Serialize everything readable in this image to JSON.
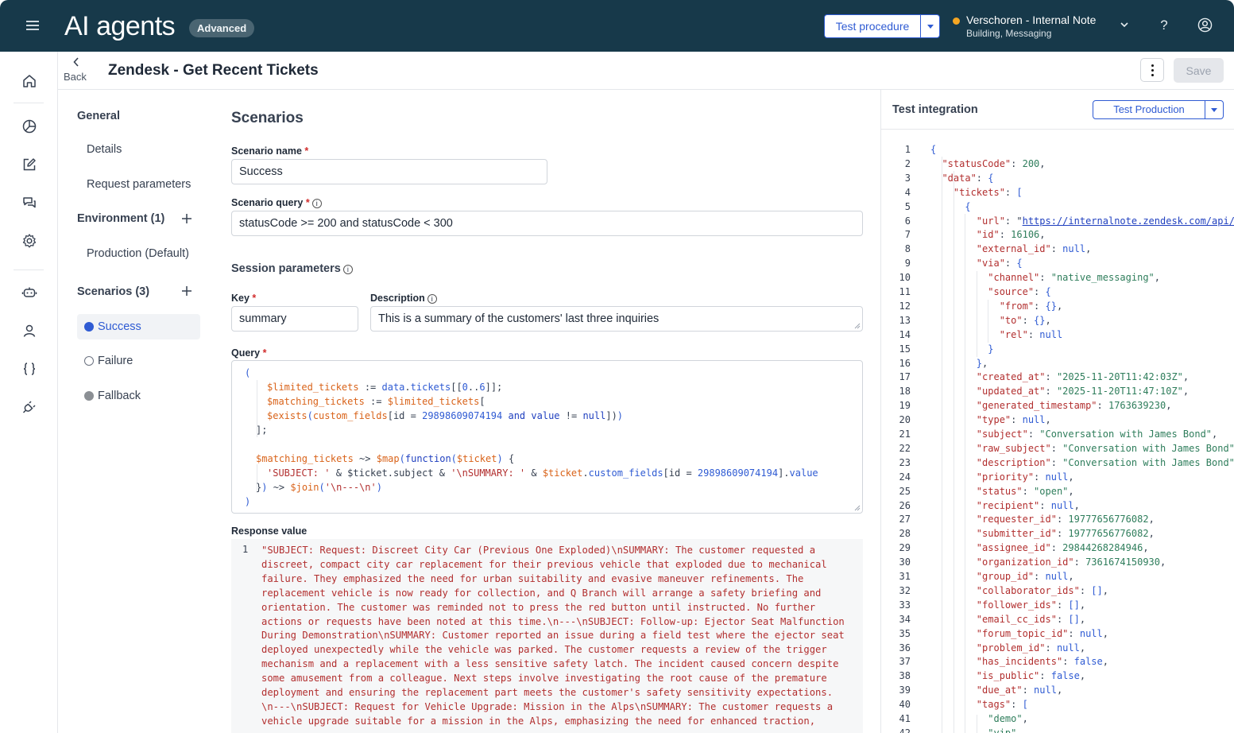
{
  "header": {
    "app_title": "AI agents",
    "badge": "Advanced",
    "test_procedure_label": "Test procedure",
    "org_name": "Verschoren - Internal Note",
    "org_sub": "Building, Messaging",
    "help": "?"
  },
  "page": {
    "back_label": "Back",
    "title": "Zendesk - Get Recent Tickets",
    "save_label": "Save"
  },
  "nav": {
    "general": "General",
    "details": "Details",
    "request_parameters": "Request parameters",
    "environment": "Environment (1)",
    "production": "Production (Default)",
    "scenarios": "Scenarios (3)",
    "scenario_items": [
      {
        "label": "Success",
        "color": "#2f5bd3"
      },
      {
        "label": "Failure",
        "color": "#ffffff"
      },
      {
        "label": "Fallback",
        "color": "#8b8f94"
      }
    ]
  },
  "form": {
    "heading": "Scenarios",
    "scenario_name_label": "Scenario name",
    "scenario_name_value": "Success",
    "scenario_query_label": "Scenario query",
    "scenario_query_value": "statusCode >= 200 and statusCode < 300",
    "session_params_heading": "Session parameters",
    "key_label": "Key",
    "key_value": "summary",
    "description_label": "Description",
    "description_value": "This is a summary of the customers' last three inquiries",
    "query_label": "Query",
    "required_mark": "*",
    "info_mark": "i",
    "query_lines": [
      [
        [
          "c-par",
          "("
        ]
      ],
      [
        [
          "c-var",
          "$limited_tickets"
        ],
        [
          "c-op",
          " := "
        ],
        [
          "c-id",
          "data"
        ],
        [
          "c-op",
          "."
        ],
        [
          "c-id",
          "tickets"
        ],
        [
          "c-op",
          "[["
        ],
        [
          "c-num",
          "0"
        ],
        [
          "c-op",
          ".."
        ],
        [
          "c-num",
          "6"
        ],
        [
          "c-op",
          "]];"
        ]
      ],
      [
        [
          "c-var",
          "$matching_tickets"
        ],
        [
          "c-op",
          " := "
        ],
        [
          "c-var",
          "$limited_tickets"
        ],
        [
          "c-op",
          "["
        ]
      ],
      [
        [
          "c-fn",
          "$exists"
        ],
        [
          "c-par",
          "("
        ],
        [
          "c-var",
          "custom_fields"
        ],
        [
          "c-op",
          "[id = "
        ],
        [
          "c-num",
          "29898609074194"
        ],
        [
          "c-op",
          " "
        ],
        [
          "c-kw",
          "and"
        ],
        [
          "c-op",
          " "
        ],
        [
          "c-kw",
          "value"
        ],
        [
          "c-op",
          " != "
        ],
        [
          "c-kw",
          "null"
        ],
        [
          "c-op",
          "])"
        ],
        [
          "c-par",
          ")"
        ]
      ],
      [
        [
          "c-op",
          "];"
        ]
      ],
      [],
      [
        [
          "c-var",
          "$matching_tickets"
        ],
        [
          "c-op",
          " ~> "
        ],
        [
          "c-fn",
          "$map"
        ],
        [
          "c-par",
          "("
        ],
        [
          "c-kw",
          "function"
        ],
        [
          "c-par",
          "("
        ],
        [
          "c-var",
          "$ticket"
        ],
        [
          "c-par",
          ")"
        ],
        [
          "c-op",
          " {"
        ]
      ],
      [
        [
          "c-str",
          "'SUBJECT: '"
        ],
        [
          "c-op",
          " & $ticket.subject & "
        ],
        [
          "c-str",
          "'\\nSUMMARY: '"
        ],
        [
          "c-op",
          " & "
        ],
        [
          "c-var",
          "$ticket"
        ],
        [
          "c-op",
          "."
        ],
        [
          "c-id",
          "custom_fields"
        ],
        [
          "c-op",
          "[id = "
        ],
        [
          "c-num",
          "29898609074194"
        ],
        [
          "c-op",
          "]."
        ],
        [
          "c-id",
          "value"
        ]
      ],
      [
        [
          "c-op",
          "}"
        ],
        [
          "c-par",
          ")"
        ],
        [
          "c-op",
          " ~> "
        ],
        [
          "c-fn",
          "$join"
        ],
        [
          "c-par",
          "("
        ],
        [
          "c-str",
          "'\\n---\\n'"
        ],
        [
          "c-par",
          ")"
        ]
      ],
      [
        [
          "c-par",
          ")"
        ]
      ]
    ],
    "response_label": "Response value",
    "response_line_no": "1",
    "response_text": "\"SUBJECT: Request: Discreet City Car (Previous One Exploded)\\nSUMMARY: The customer requested a\ndiscreet, compact city car replacement for their previous vehicle that exploded due to mechanical\nfailure. They emphasized the need for urban suitability and evasive maneuver refinements. The\nreplacement vehicle is now ready for collection, and Q Branch will arrange a safety briefing and\norientation. The customer was reminded not to press the red button until instructed. No further\nactions or requests have been noted at this time.\\n---\\nSUBJECT: Follow-up: Ejector Seat Malfunction\nDuring Demonstration\\nSUMMARY: Customer reported an issue during a field test where the ejector seat\ndeployed unexpectedly while the vehicle was parked. The customer requests a review of the trigger\nmechanism and a replacement with a less sensitive safety latch. The incident caused concern despite\nsome amusement from a colleague. Next steps involve investigating the root cause of the premature\ndeployment and ensuring the replacement part meets the customer's safety sensitivity expectations.\n\\n---\\nSUBJECT: Request for Vehicle Upgrade: Mission in the Alps\\nSUMMARY: The customer requests a\nvehicle upgrade suitable for a mission in the Alps, emphasizing the need for enhanced traction,"
  },
  "right_panel": {
    "title": "Test integration",
    "test_production_label": "Test Production",
    "json_lines": [
      {
        "n": "1",
        "t": [
          [
            "j-p",
            "{"
          ]
        ]
      },
      {
        "n": "2",
        "t": [
          [
            "j-key",
            "  \"statusCode\""
          ],
          [
            "j-c",
            ": "
          ],
          [
            "j-n",
            "200"
          ],
          [
            "j-c",
            ","
          ]
        ]
      },
      {
        "n": "3",
        "t": [
          [
            "j-key",
            "  \"data\""
          ],
          [
            "j-c",
            ": "
          ],
          [
            "j-p",
            "{"
          ]
        ]
      },
      {
        "n": "4",
        "t": [
          [
            "j-key",
            "    \"tickets\""
          ],
          [
            "j-c",
            ": "
          ],
          [
            "j-p",
            "["
          ]
        ]
      },
      {
        "n": "5",
        "t": [
          [
            "j-p",
            "      {"
          ]
        ]
      },
      {
        "n": "6",
        "t": [
          [
            "j-key",
            "        \"url\""
          ],
          [
            "j-c",
            ": \""
          ],
          [
            "j-url",
            "https://internalnote.zendesk.com/api/"
          ]
        ]
      },
      {
        "n": "7",
        "t": [
          [
            "j-key",
            "        \"id\""
          ],
          [
            "j-c",
            ": "
          ],
          [
            "j-n",
            "16106"
          ],
          [
            "j-c",
            ","
          ]
        ]
      },
      {
        "n": "8",
        "t": [
          [
            "j-key",
            "        \"external_id\""
          ],
          [
            "j-c",
            ": "
          ],
          [
            "j-kw",
            "null"
          ],
          [
            "j-c",
            ","
          ]
        ]
      },
      {
        "n": "9",
        "t": [
          [
            "j-key",
            "        \"via\""
          ],
          [
            "j-c",
            ": "
          ],
          [
            "j-p",
            "{"
          ]
        ]
      },
      {
        "n": "10",
        "t": [
          [
            "j-key",
            "          \"channel\""
          ],
          [
            "j-c",
            ": "
          ],
          [
            "j-str",
            "\"native_messaging\""
          ],
          [
            "j-c",
            ","
          ]
        ]
      },
      {
        "n": "11",
        "t": [
          [
            "j-key",
            "          \"source\""
          ],
          [
            "j-c",
            ": "
          ],
          [
            "j-p",
            "{"
          ]
        ]
      },
      {
        "n": "12",
        "t": [
          [
            "j-key",
            "            \"from\""
          ],
          [
            "j-c",
            ": "
          ],
          [
            "j-p",
            "{}"
          ],
          [
            "j-c",
            ","
          ]
        ]
      },
      {
        "n": "13",
        "t": [
          [
            "j-key",
            "            \"to\""
          ],
          [
            "j-c",
            ": "
          ],
          [
            "j-p",
            "{}"
          ],
          [
            "j-c",
            ","
          ]
        ]
      },
      {
        "n": "14",
        "t": [
          [
            "j-key",
            "            \"rel\""
          ],
          [
            "j-c",
            ": "
          ],
          [
            "j-kw",
            "null"
          ]
        ]
      },
      {
        "n": "15",
        "t": [
          [
            "j-p",
            "          }"
          ]
        ]
      },
      {
        "n": "16",
        "t": [
          [
            "j-p",
            "        }"
          ],
          [
            "j-c",
            ","
          ]
        ]
      },
      {
        "n": "17",
        "t": [
          [
            "j-key",
            "        \"created_at\""
          ],
          [
            "j-c",
            ": "
          ],
          [
            "j-str",
            "\"2025-11-20T11:42:03Z\""
          ],
          [
            "j-c",
            ","
          ]
        ]
      },
      {
        "n": "18",
        "t": [
          [
            "j-key",
            "        \"updated_at\""
          ],
          [
            "j-c",
            ": "
          ],
          [
            "j-str",
            "\"2025-11-20T11:47:10Z\""
          ],
          [
            "j-c",
            ","
          ]
        ]
      },
      {
        "n": "19",
        "t": [
          [
            "j-key",
            "        \"generated_timestamp\""
          ],
          [
            "j-c",
            ": "
          ],
          [
            "j-n",
            "1763639230"
          ],
          [
            "j-c",
            ","
          ]
        ]
      },
      {
        "n": "20",
        "t": [
          [
            "j-key",
            "        \"type\""
          ],
          [
            "j-c",
            ": "
          ],
          [
            "j-kw",
            "null"
          ],
          [
            "j-c",
            ","
          ]
        ]
      },
      {
        "n": "21",
        "t": [
          [
            "j-key",
            "        \"subject\""
          ],
          [
            "j-c",
            ": "
          ],
          [
            "j-str",
            "\"Conversation with James Bond\""
          ],
          [
            "j-c",
            ","
          ]
        ]
      },
      {
        "n": "22",
        "t": [
          [
            "j-key",
            "        \"raw_subject\""
          ],
          [
            "j-c",
            ": "
          ],
          [
            "j-str",
            "\"Conversation with James Bond\""
          ]
        ]
      },
      {
        "n": "23",
        "t": [
          [
            "j-key",
            "        \"description\""
          ],
          [
            "j-c",
            ": "
          ],
          [
            "j-str",
            "\"Conversation with James Bond\""
          ]
        ]
      },
      {
        "n": "24",
        "t": [
          [
            "j-key",
            "        \"priority\""
          ],
          [
            "j-c",
            ": "
          ],
          [
            "j-kw",
            "null"
          ],
          [
            "j-c",
            ","
          ]
        ]
      },
      {
        "n": "25",
        "t": [
          [
            "j-key",
            "        \"status\""
          ],
          [
            "j-c",
            ": "
          ],
          [
            "j-str",
            "\"open\""
          ],
          [
            "j-c",
            ","
          ]
        ]
      },
      {
        "n": "26",
        "t": [
          [
            "j-key",
            "        \"recipient\""
          ],
          [
            "j-c",
            ": "
          ],
          [
            "j-kw",
            "null"
          ],
          [
            "j-c",
            ","
          ]
        ]
      },
      {
        "n": "27",
        "t": [
          [
            "j-key",
            "        \"requester_id\""
          ],
          [
            "j-c",
            ": "
          ],
          [
            "j-n",
            "19777656776082"
          ],
          [
            "j-c",
            ","
          ]
        ]
      },
      {
        "n": "28",
        "t": [
          [
            "j-key",
            "        \"submitter_id\""
          ],
          [
            "j-c",
            ": "
          ],
          [
            "j-n",
            "19777656776082"
          ],
          [
            "j-c",
            ","
          ]
        ]
      },
      {
        "n": "29",
        "t": [
          [
            "j-key",
            "        \"assignee_id\""
          ],
          [
            "j-c",
            ": "
          ],
          [
            "j-n",
            "29844268284946"
          ],
          [
            "j-c",
            ","
          ]
        ]
      },
      {
        "n": "30",
        "t": [
          [
            "j-key",
            "        \"organization_id\""
          ],
          [
            "j-c",
            ": "
          ],
          [
            "j-n",
            "7361674150930"
          ],
          [
            "j-c",
            ","
          ]
        ]
      },
      {
        "n": "31",
        "t": [
          [
            "j-key",
            "        \"group_id\""
          ],
          [
            "j-c",
            ": "
          ],
          [
            "j-kw",
            "null"
          ],
          [
            "j-c",
            ","
          ]
        ]
      },
      {
        "n": "32",
        "t": [
          [
            "j-key",
            "        \"collaborator_ids\""
          ],
          [
            "j-c",
            ": "
          ],
          [
            "j-p",
            "[]"
          ],
          [
            "j-c",
            ","
          ]
        ]
      },
      {
        "n": "33",
        "t": [
          [
            "j-key",
            "        \"follower_ids\""
          ],
          [
            "j-c",
            ": "
          ],
          [
            "j-p",
            "[]"
          ],
          [
            "j-c",
            ","
          ]
        ]
      },
      {
        "n": "34",
        "t": [
          [
            "j-key",
            "        \"email_cc_ids\""
          ],
          [
            "j-c",
            ": "
          ],
          [
            "j-p",
            "[]"
          ],
          [
            "j-c",
            ","
          ]
        ]
      },
      {
        "n": "35",
        "t": [
          [
            "j-key",
            "        \"forum_topic_id\""
          ],
          [
            "j-c",
            ": "
          ],
          [
            "j-kw",
            "null"
          ],
          [
            "j-c",
            ","
          ]
        ]
      },
      {
        "n": "36",
        "t": [
          [
            "j-key",
            "        \"problem_id\""
          ],
          [
            "j-c",
            ": "
          ],
          [
            "j-kw",
            "null"
          ],
          [
            "j-c",
            ","
          ]
        ]
      },
      {
        "n": "37",
        "t": [
          [
            "j-key",
            "        \"has_incidents\""
          ],
          [
            "j-c",
            ": "
          ],
          [
            "j-kw",
            "false"
          ],
          [
            "j-c",
            ","
          ]
        ]
      },
      {
        "n": "38",
        "t": [
          [
            "j-key",
            "        \"is_public\""
          ],
          [
            "j-c",
            ": "
          ],
          [
            "j-kw",
            "false"
          ],
          [
            "j-c",
            ","
          ]
        ]
      },
      {
        "n": "39",
        "t": [
          [
            "j-key",
            "        \"due_at\""
          ],
          [
            "j-c",
            ": "
          ],
          [
            "j-kw",
            "null"
          ],
          [
            "j-c",
            ","
          ]
        ]
      },
      {
        "n": "40",
        "t": [
          [
            "j-key",
            "        \"tags\""
          ],
          [
            "j-c",
            ": "
          ],
          [
            "j-p",
            "["
          ]
        ]
      },
      {
        "n": "41",
        "t": [
          [
            "j-str",
            "          \"demo\""
          ],
          [
            "j-c",
            ","
          ]
        ]
      },
      {
        "n": "42",
        "t": [
          [
            "j-str",
            "          \"vip\""
          ]
        ]
      }
    ]
  }
}
